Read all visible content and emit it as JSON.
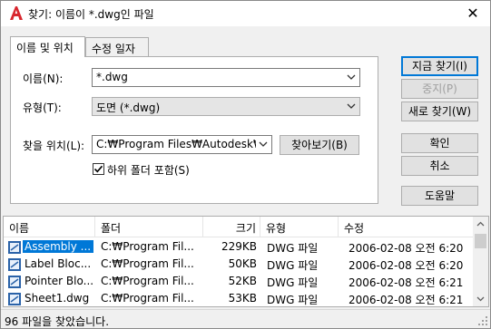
{
  "window": {
    "title": "찾기: 이름이 *.dwg인 파일",
    "close_glyph": "✕"
  },
  "tabs": [
    {
      "label": "이름 및 위치",
      "active": true
    },
    {
      "label": "수정 일자",
      "active": false
    }
  ],
  "form": {
    "name_label": "이름(N):",
    "name_value": "*.dwg",
    "type_label": "유형(T):",
    "type_value": "도면 (*.dwg)",
    "location_label": "찾을 위치(L):",
    "location_value": "C:₩Program Files₩Autodesk₩",
    "browse_label": "찾아보기(B)",
    "subfolders_label": "하위 폴더 포함(S)",
    "subfolders_checked": true
  },
  "actions": {
    "find_now": "지금 찾기(I)",
    "stop": "중지(P)",
    "new_search": "새로 찾기(W)",
    "ok": "확인",
    "cancel": "취소",
    "help": "도움말"
  },
  "results": {
    "columns": [
      "이름",
      "폴더",
      "크기",
      "유형",
      "수정"
    ],
    "rows": [
      {
        "name": "Assembly ...",
        "folder": "C:₩Program Fil...",
        "size": "229KB",
        "type": "DWG 파일",
        "modified": "2006-02-08 오전 6:20",
        "selected": true
      },
      {
        "name": "Label Bloc...",
        "folder": "C:₩Program Fil...",
        "size": "50KB",
        "type": "DWG 파일",
        "modified": "2006-02-08 오전 6:20",
        "selected": false
      },
      {
        "name": "Pointer Blo...",
        "folder": "C:₩Program Fil...",
        "size": "52KB",
        "type": "DWG 파일",
        "modified": "2006-02-08 오전 6:21",
        "selected": false
      },
      {
        "name": "Sheet1.dwg",
        "folder": "C:₩Program Fil...",
        "size": "53KB",
        "type": "DWG 파일",
        "modified": "2006-02-08 오전 6:21",
        "selected": false
      }
    ]
  },
  "status": {
    "text": "96 파일을 찾았습니다."
  },
  "colors": {
    "accent": "#0078d7",
    "app_icon": "#d8262e"
  },
  "icons": [
    "autocad-app-icon",
    "close-icon",
    "chevron-down-icon",
    "checkmark-icon",
    "dwg-file-icon",
    "scroll-up-icon",
    "scroll-down-icon",
    "resize-grip-icon"
  ]
}
